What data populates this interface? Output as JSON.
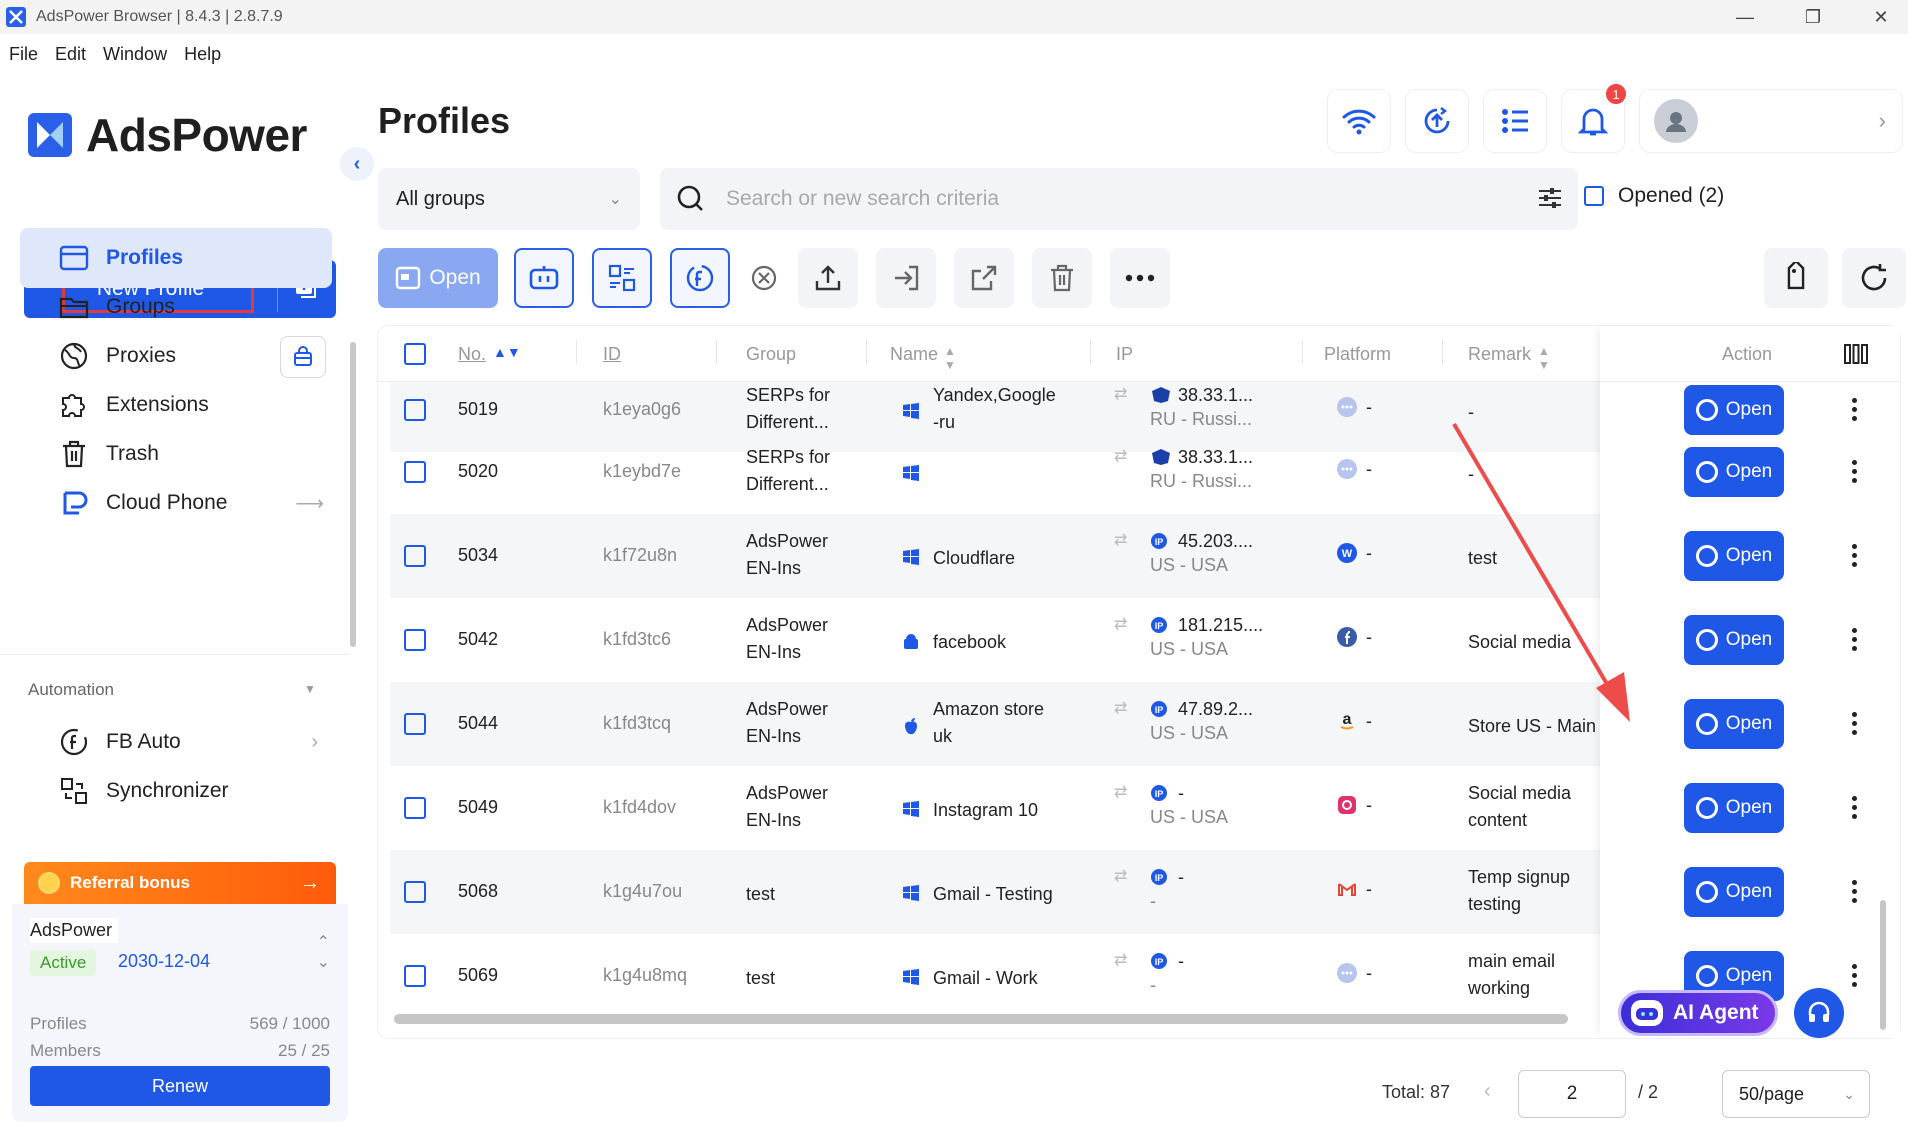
{
  "window": {
    "title": "AdsPower Browser | 8.4.3 | 2.8.7.9"
  },
  "menu": [
    "File",
    "Edit",
    "Window",
    "Help"
  ],
  "sidebar": {
    "brand": "AdsPower",
    "new_profile": "New Profile",
    "nav": [
      {
        "label": "Profiles",
        "icon": "profiles-icon",
        "active": true
      },
      {
        "label": "Groups",
        "icon": "folder-icon"
      },
      {
        "label": "Proxies",
        "icon": "globe-icon"
      },
      {
        "label": "Extensions",
        "icon": "puzzle-icon"
      },
      {
        "label": "Trash",
        "icon": "trash-icon"
      },
      {
        "label": "Cloud Phone",
        "icon": "cloud-phone-icon"
      }
    ],
    "automation_label": "Automation",
    "automation": [
      {
        "label": "FB Auto",
        "icon": "facebook-auto-icon"
      },
      {
        "label": "Synchronizer",
        "icon": "synchronizer-icon"
      }
    ],
    "referral": "Referral bonus",
    "plan": {
      "name": "AdsPower",
      "status": "Active",
      "expiry": "2030-12-04",
      "profiles_label": "Profiles",
      "profiles_value": "569 / 1000",
      "members_label": "Members",
      "members_value": "25 / 25",
      "renew": "Renew"
    }
  },
  "main": {
    "title": "Profiles",
    "notification_count": "1",
    "group_select": "All groups",
    "search_placeholder": "Search or new search criteria",
    "opened_label": "Opened (2)",
    "open_button": "Open",
    "columns": {
      "no": "No.",
      "id": "ID",
      "group": "Group",
      "name": "Name",
      "ip": "IP",
      "platform": "Platform",
      "remark": "Remark",
      "action": "Action"
    },
    "action_label": "Open",
    "rows": [
      {
        "no": "5019",
        "id": "k1eya0g6",
        "group1": "SERPs for",
        "group2": "Different...",
        "name1": "Yandex,Google",
        "name2": "-ru",
        "ip1": "38.33.1...",
        "ip2": "RU - Russi...",
        "platform": "-",
        "remark1": "-",
        "remark2": ""
      },
      {
        "no": "5020",
        "id": "k1eybd7e",
        "group1": "SERPs for",
        "group2": "Different...",
        "name1": "",
        "name2": "",
        "ip1": "38.33.1...",
        "ip2": "RU - Russi...",
        "platform": "-",
        "remark1": "-",
        "remark2": ""
      },
      {
        "no": "5034",
        "id": "k1f72u8n",
        "group1": "AdsPower",
        "group2": "EN-Ins",
        "name1": "Cloudflare",
        "name2": "",
        "ip1": "45.203....",
        "ip2": "US - USA",
        "platform": "-",
        "remark1": "test",
        "remark2": ""
      },
      {
        "no": "5042",
        "id": "k1fd3tc6",
        "group1": "AdsPower",
        "group2": "EN-Ins",
        "name1": "facebook",
        "name2": "",
        "ip1": "181.215....",
        "ip2": "US - USA",
        "platform": "-",
        "remark1": "Social media",
        "remark2": ""
      },
      {
        "no": "5044",
        "id": "k1fd3tcq",
        "group1": "AdsPower",
        "group2": "EN-Ins",
        "name1": "Amazon store",
        "name2": "uk",
        "ip1": "47.89.2...",
        "ip2": "US - USA",
        "platform": "-",
        "remark1": "Store US - Main",
        "remark2": ""
      },
      {
        "no": "5049",
        "id": "k1fd4dov",
        "group1": "AdsPower",
        "group2": "EN-Ins",
        "name1": "Instagram 10",
        "name2": "",
        "ip1": "-",
        "ip2": "US - USA",
        "platform": "-",
        "remark1": "Social media",
        "remark2": "content"
      },
      {
        "no": "5068",
        "id": "k1g4u7ou",
        "group1": "test",
        "group2": "",
        "name1": "Gmail - Testing",
        "name2": "",
        "ip1": "-",
        "ip2": "-",
        "platform": "-",
        "remark1": "Temp signup",
        "remark2": "testing"
      },
      {
        "no": "5069",
        "id": "k1g4u8mq",
        "group1": "test",
        "group2": "",
        "name1": "Gmail - Work",
        "name2": "",
        "ip1": "-",
        "ip2": "-",
        "platform": "-",
        "remark1": "main email",
        "remark2": "working"
      }
    ],
    "pagination": {
      "total": "Total: 87",
      "page": "2",
      "pages": "/ 2",
      "per_page": "50/page"
    },
    "ai_agent": "AI Agent"
  },
  "colors": {
    "accent": "#1f58e6",
    "annotation": "#e23b3b",
    "referral": "#ff6a10"
  }
}
